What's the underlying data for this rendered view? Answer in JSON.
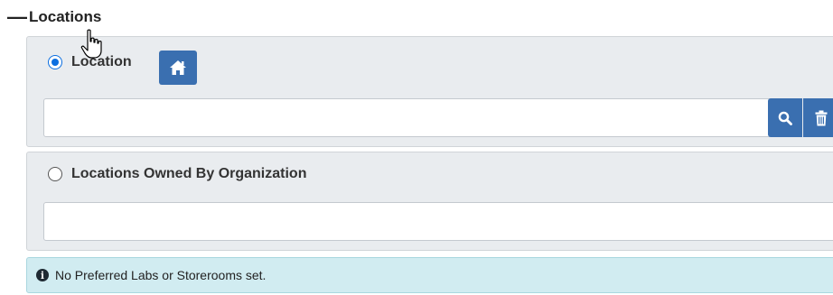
{
  "section": {
    "toggle_symbol": "—",
    "title": "Locations"
  },
  "location_option": {
    "label": "Location",
    "selected": true,
    "value": ""
  },
  "organization_option": {
    "label": "Locations Owned By Organization",
    "selected": false,
    "value": ""
  },
  "alert": {
    "icon": "info-circle-icon",
    "icon_glyph": "i",
    "message": "No Preferred Labs or Storerooms set."
  },
  "colors": {
    "accent_button": "#3a6fb0",
    "panel_background": "#e9ecef",
    "alert_background": "#d1ecf1",
    "radio_selected": "#0b6ee0"
  }
}
